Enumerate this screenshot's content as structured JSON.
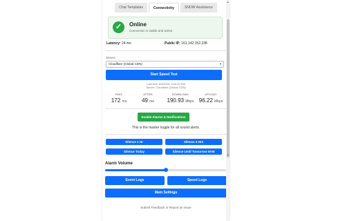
{
  "tabs": [
    "Chat Templates",
    "Connectivity",
    "SNOW Assistance"
  ],
  "status": {
    "title": "Online",
    "subtitle": "Connection is stable and active."
  },
  "info": {
    "latency_label": "Latency:",
    "latency_value": "24 ms",
    "ip_label": "Public IP:",
    "ip_value": "161.142.152.238"
  },
  "server": {
    "label": "Server:",
    "selected": "Cloudflare (Global CDN)"
  },
  "speed_test": {
    "button_label": "Start Speed Test",
    "last_test_line1": "Last test: 8/4/2025, 3:09:40 PM",
    "last_test_line2": "Server: Cloudflare (Global CDN)"
  },
  "metrics": [
    {
      "label": "PING:",
      "value": "172",
      "unit": "ms"
    },
    {
      "label": "JITTER:",
      "value": "49",
      "unit": "ms"
    },
    {
      "label": "DOWNLOAD:",
      "value": "190.93",
      "unit": "Mbps"
    },
    {
      "label": "UPLOAD:",
      "value": "96.22",
      "unit": "Mbps"
    }
  ],
  "alarms": {
    "button_label": "Enable Alarms & Notifications",
    "note": "This is the master toggle for all sound alerts."
  },
  "silence_buttons": [
    "Silence 1 Hr",
    "Silence 4 Hrs",
    "Silence Today",
    "Silence Until Tomorrow 9AM"
  ],
  "volume": {
    "label": "Alarm Volume",
    "level": 0.5
  },
  "logs": {
    "event_logs": "Event Logs",
    "speed_logs": "Speed Logs",
    "main_settings": "Main Settings"
  },
  "footer": {
    "feedback": "Submit Feedback or Report an Issue"
  },
  "colors": {
    "primary": "#0d6efd",
    "success": "#28a745"
  }
}
